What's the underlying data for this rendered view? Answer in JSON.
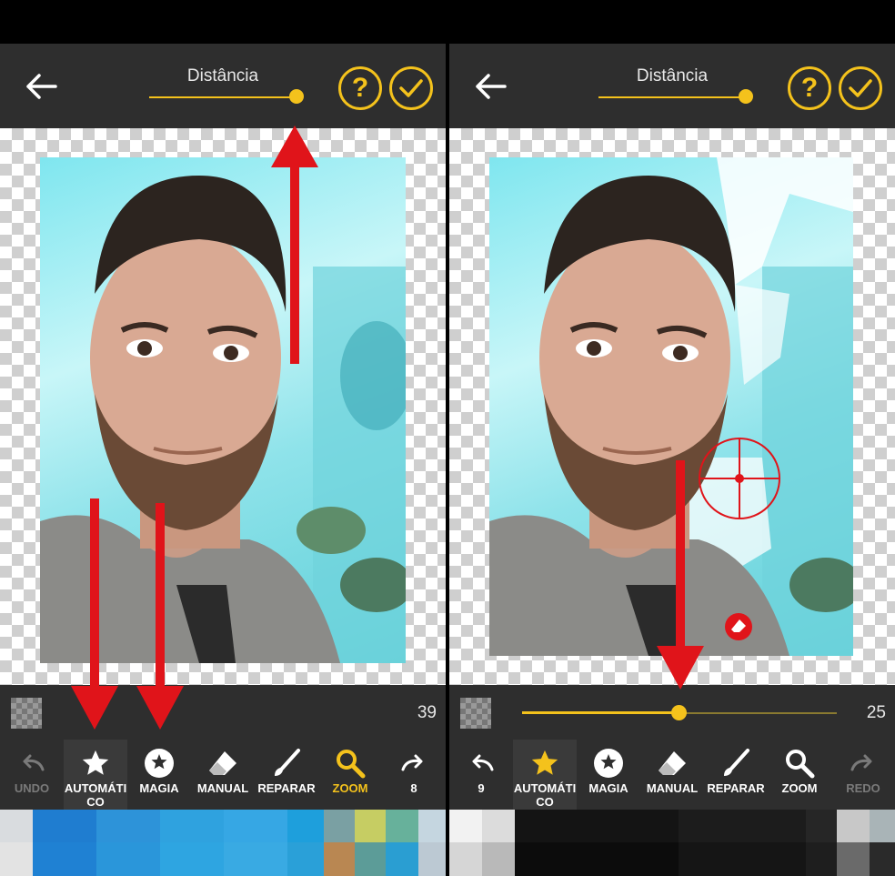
{
  "left_panel": {
    "topbar": {
      "title": "Distância",
      "help_label": "?",
      "confirm_label": "✓"
    },
    "slider": {
      "value": "39"
    },
    "tools": [
      {
        "id": "undo",
        "label": "UNDO",
        "icon": "undo-icon",
        "disabled": true
      },
      {
        "id": "automatico",
        "label": "AUTOMÁTI CO",
        "icon": "star-icon",
        "active": true
      },
      {
        "id": "magia",
        "label": "MAGIA",
        "icon": "magic-star-icon"
      },
      {
        "id": "manual",
        "label": "MANUAL",
        "icon": "eraser-icon"
      },
      {
        "id": "reparar",
        "label": "REPARAR",
        "icon": "brush-icon"
      },
      {
        "id": "zoom",
        "label": "ZOOM",
        "icon": "zoom-icon",
        "highlight": true
      },
      {
        "id": "redo",
        "label": "8",
        "icon": "redo-icon"
      }
    ]
  },
  "right_panel": {
    "topbar": {
      "title": "Distância",
      "help_label": "?",
      "confirm_label": "✓"
    },
    "slider": {
      "value": "25",
      "fraction": 0.5
    },
    "tools": [
      {
        "id": "undo",
        "label": "9",
        "icon": "undo-icon"
      },
      {
        "id": "automatico",
        "label": "AUTOMÁTI CO",
        "icon": "star-icon",
        "active": true
      },
      {
        "id": "magia",
        "label": "MAGIA",
        "icon": "magic-star-icon"
      },
      {
        "id": "manual",
        "label": "MANUAL",
        "icon": "eraser-icon"
      },
      {
        "id": "reparar",
        "label": "REPARAR",
        "icon": "brush-icon"
      },
      {
        "id": "zoom",
        "label": "ZOOM",
        "icon": "zoom-icon"
      },
      {
        "id": "redo",
        "label": "REDO",
        "icon": "redo-icon",
        "disabled": true
      }
    ]
  },
  "colors": {
    "accent": "#f4c21c",
    "bar": "#2e2e2e",
    "arrow": "#e0141a"
  }
}
